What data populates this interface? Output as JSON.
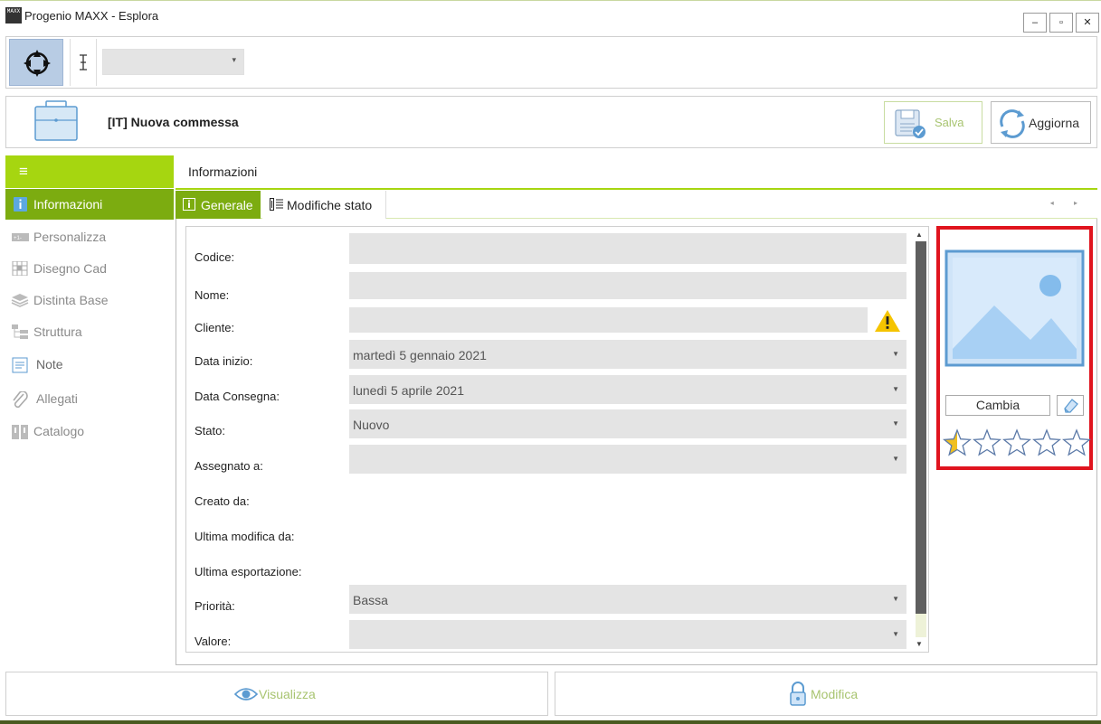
{
  "window": {
    "title": "Progenio MAXX - Esplora",
    "logo_text": "MAXX",
    "minimize": "–",
    "maximize": "▫",
    "close": "✕"
  },
  "toolbar": {
    "combo_value": "",
    "combo_arrow": "▾"
  },
  "header": {
    "title": "[IT] Nuova commessa",
    "save_label": "Salva",
    "refresh_label": "Aggiorna"
  },
  "sidebar": {
    "menu_icon": "≡",
    "items": [
      {
        "label": "Informazioni",
        "icon": "info-icon"
      },
      {
        "label": "Personalizza",
        "icon": "customize-icon"
      },
      {
        "label": "Disegno Cad",
        "icon": "cad-icon"
      },
      {
        "label": "Distinta Base",
        "icon": "layers-icon"
      },
      {
        "label": "Struttura",
        "icon": "tree-icon"
      },
      {
        "label": "Note",
        "icon": "note-icon"
      },
      {
        "label": "Allegati",
        "icon": "paperclip-icon"
      },
      {
        "label": "Catalogo",
        "icon": "catalog-icon"
      }
    ]
  },
  "main": {
    "section_title": "Informazioni",
    "tabs": [
      {
        "label": "Generale"
      },
      {
        "label": "Modifiche stato"
      }
    ],
    "tab_scroll": "◂ ▸"
  },
  "form": {
    "codice_label": "Codice:",
    "codice_value": "",
    "nome_label": "Nome:",
    "nome_value": "",
    "cliente_label": "Cliente:",
    "cliente_value": "",
    "data_inizio_label": "Data inizio:",
    "data_inizio_value": "martedì 5 gennaio 2021",
    "data_consegna_label": "Data Consegna:",
    "data_consegna_value": "lunedì 5 aprile 2021",
    "stato_label": "Stato:",
    "stato_value": "Nuovo",
    "assegnato_label": "Assegnato a:",
    "assegnato_value": "",
    "creato_label": "Creato da:",
    "ultima_modifica_label": "Ultima modifica da:",
    "ultima_esportazione_label": "Ultima esportazione:",
    "priorita_label": "Priorità:",
    "priorita_value": "Bassa",
    "valore_label": "Valore:",
    "valore_value": "",
    "dropdown_arrow": "▼"
  },
  "image_panel": {
    "change_label": "Cambia",
    "rating": 0.5,
    "max_rating": 5
  },
  "bottom": {
    "view_label": "Visualizza",
    "edit_label": "Modifica"
  },
  "colors": {
    "accent_green": "#a6d610",
    "active_green": "#7cac10",
    "highlight_red": "#e0141e",
    "warning_yellow": "#f5c400"
  }
}
